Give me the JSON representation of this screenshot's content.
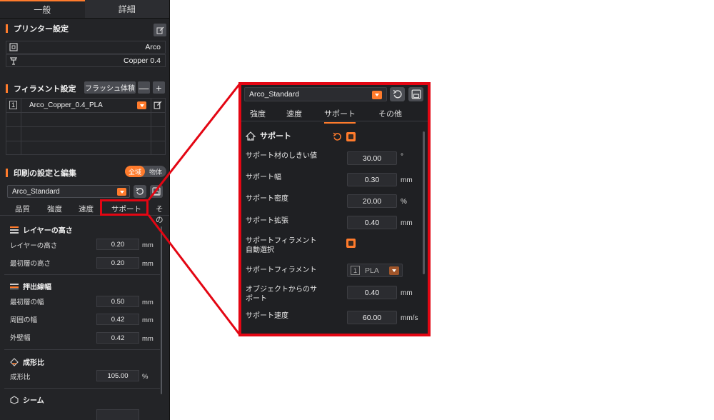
{
  "left": {
    "tabs": [
      "一般",
      "詳細"
    ],
    "printer": {
      "title": "プリンター設定",
      "model": "Arco",
      "nozzle": "Copper 0.4"
    },
    "filament": {
      "title": "フィラメント設定",
      "flush_label": "フラッシュ体積",
      "minus": "—",
      "plus": "+",
      "slot_number": "1",
      "name": "Arco_Copper_0.4_PLA"
    },
    "print": {
      "title": "印刷の設定と編集",
      "toggle_all": "全域",
      "toggle_object": "物体",
      "preset": "Arco_Standard",
      "tabs": [
        "品質",
        "強度",
        "速度",
        "サポート",
        "その"
      ]
    },
    "quality": {
      "layer_height_group": "レイヤーの高さ",
      "layer_height_label": "レイヤーの高さ",
      "layer_height_value": "0.20",
      "first_layer_label": "最初層の高さ",
      "first_layer_value": "0.20",
      "line_width_group": "押出線幅",
      "first_layer_width_label": "最初層の幅",
      "first_layer_width_value": "0.50",
      "perimeter_width_label": "周囲の幅",
      "perimeter_width_value": "0.42",
      "outer_wall_width_label": "外壁幅",
      "outer_wall_width_value": "0.42",
      "ratio_group": "成形比",
      "ratio_label": "成形比",
      "ratio_value": "105.00",
      "ratio_unit": "%",
      "seam_group": "シーム",
      "unit_mm": "mm"
    }
  },
  "zoom": {
    "preset": "Arco_Standard",
    "tabs": [
      "強度",
      "速度",
      "サポート",
      "その他"
    ],
    "group_title": "サポート",
    "params": {
      "threshold_label": "サポート材のしきい値",
      "threshold_value": "30.00",
      "threshold_unit": "°",
      "width_label": "サポート幅",
      "width_value": "0.30",
      "density_label": "サポート密度",
      "density_value": "20.00",
      "density_unit": "%",
      "expansion_label": "サポート拡張",
      "expansion_value": "0.40",
      "auto_filament_label_1": "サポートフィラメント",
      "auto_filament_label_2": "自動選択",
      "filament_label": "サポートフィラメント",
      "filament_slot": "1",
      "filament_value": "PLA",
      "distance_label_1": "オブジェクトからのサ",
      "distance_label_2": "ポート",
      "distance_value": "0.40",
      "speed_label": "サポート速度",
      "speed_value": "60.00",
      "speed_unit": "mm/s",
      "unit_mm": "mm"
    }
  },
  "colors": {
    "accent": "#ff7b2c",
    "highlight": "#e30613",
    "panel_bg": "#232427"
  }
}
